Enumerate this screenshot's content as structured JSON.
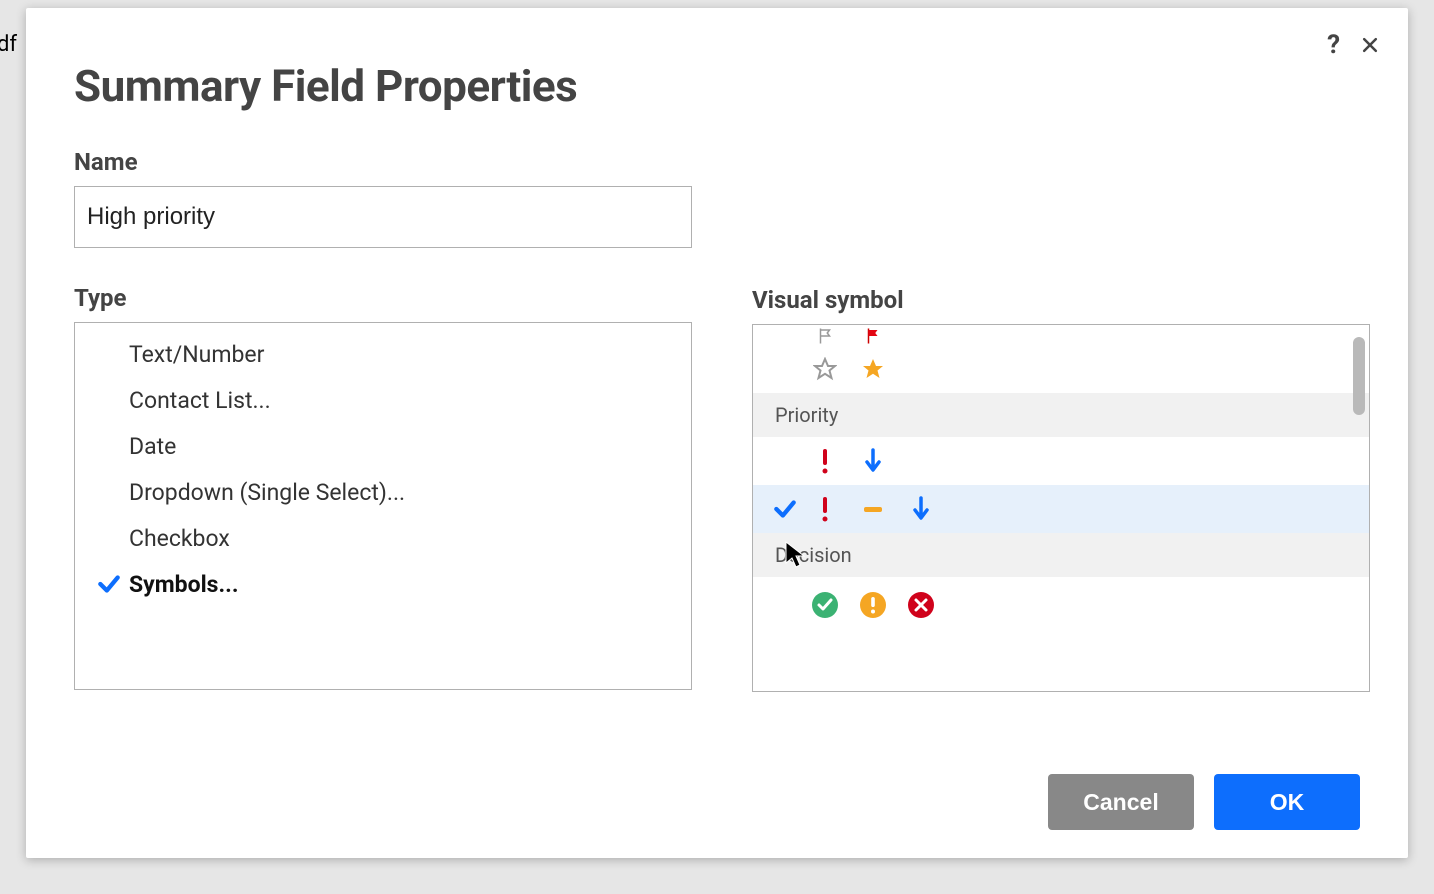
{
  "bg_fragment": "df",
  "dialog": {
    "title": "Summary Field Properties",
    "help_icon": "?",
    "close_icon": "close"
  },
  "name": {
    "label": "Name",
    "value": "High priority"
  },
  "type": {
    "label": "Type",
    "items": [
      {
        "label": "Text/Number",
        "selected": false
      },
      {
        "label": "Contact List...",
        "selected": false
      },
      {
        "label": "Date",
        "selected": false
      },
      {
        "label": "Dropdown (Single Select)...",
        "selected": false
      },
      {
        "label": "Checkbox",
        "selected": false
      },
      {
        "label": "Symbols...",
        "selected": true
      }
    ]
  },
  "visual_symbol": {
    "label": "Visual symbol",
    "sections": {
      "priority": "Priority",
      "decision": "Decision"
    }
  },
  "buttons": {
    "cancel": "Cancel",
    "ok": "OK"
  }
}
